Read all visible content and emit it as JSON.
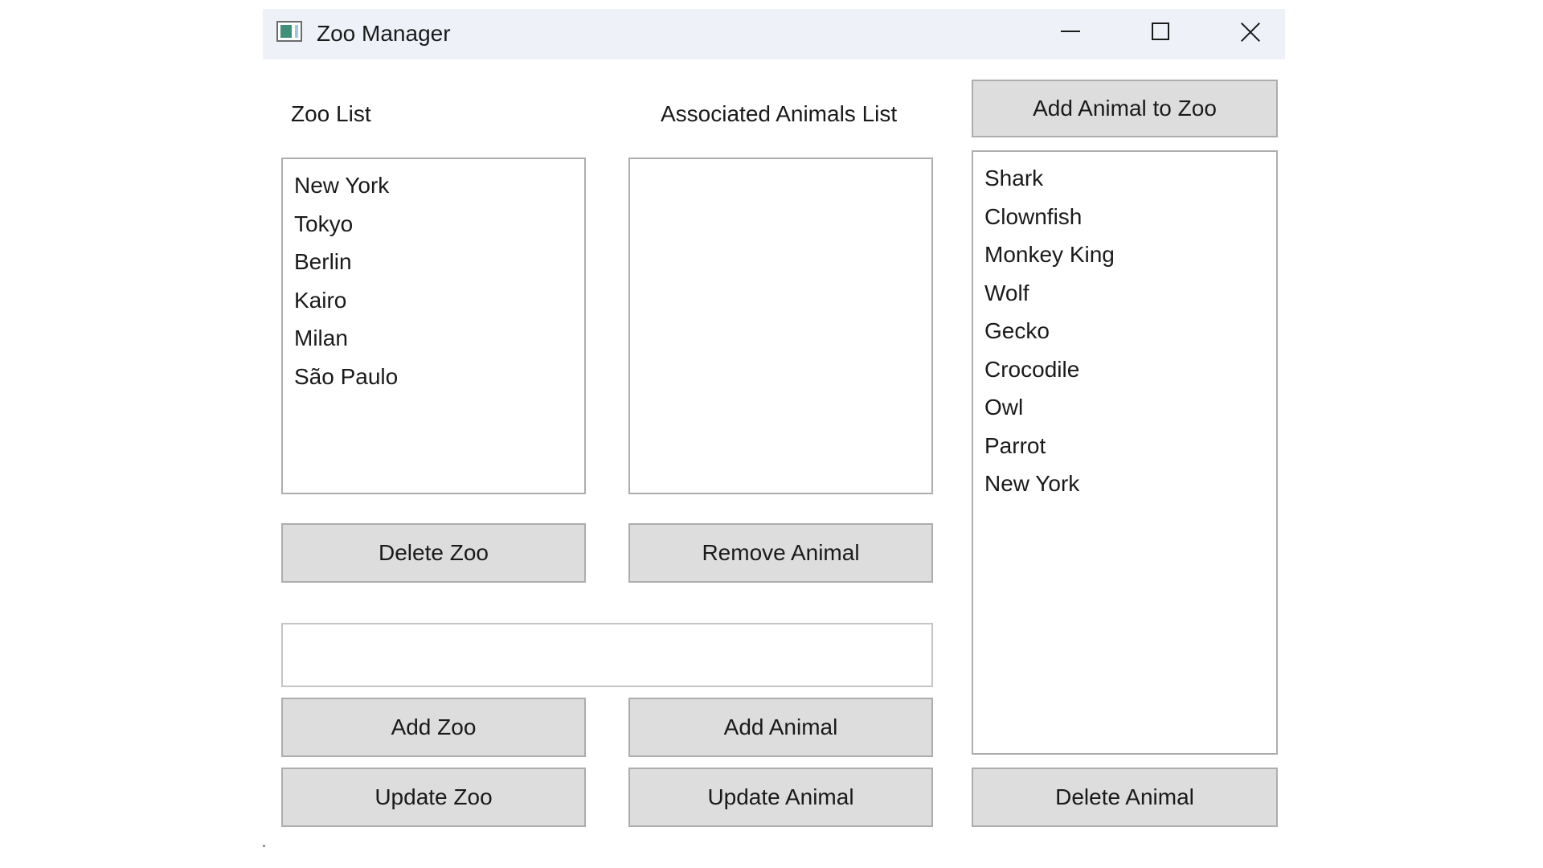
{
  "window": {
    "title": "Zoo Manager",
    "icon": "app-window-icon",
    "controls": {
      "minimize_icon": "minimize-icon",
      "maximize_icon": "maximize-icon",
      "close_icon": "close-icon"
    }
  },
  "zoo_list": {
    "heading": "Zoo List",
    "items": [
      "New York",
      "Tokyo",
      "Berlin",
      "Kairo",
      "Milan",
      "São Paulo"
    ]
  },
  "associated_animals": {
    "heading": "Associated Animals List",
    "items": []
  },
  "all_animals": {
    "items": [
      "Shark",
      "Clownfish",
      "Monkey King",
      "Wolf",
      "Gecko",
      "Crocodile",
      "Owl",
      "Parrot",
      "New York"
    ]
  },
  "buttons": {
    "add_animal_to_zoo": "Add Animal to Zoo",
    "delete_zoo": "Delete Zoo",
    "remove_animal": "Remove Animal",
    "add_zoo": "Add Zoo",
    "add_animal": "Add Animal",
    "update_zoo": "Update Zoo",
    "update_animal": "Update Animal",
    "delete_animal": "Delete Animal"
  },
  "input": {
    "value": "",
    "placeholder": ""
  },
  "colors": {
    "titlebar": "#eef2f8",
    "button_face": "#dddddd",
    "border": "#adadad"
  }
}
